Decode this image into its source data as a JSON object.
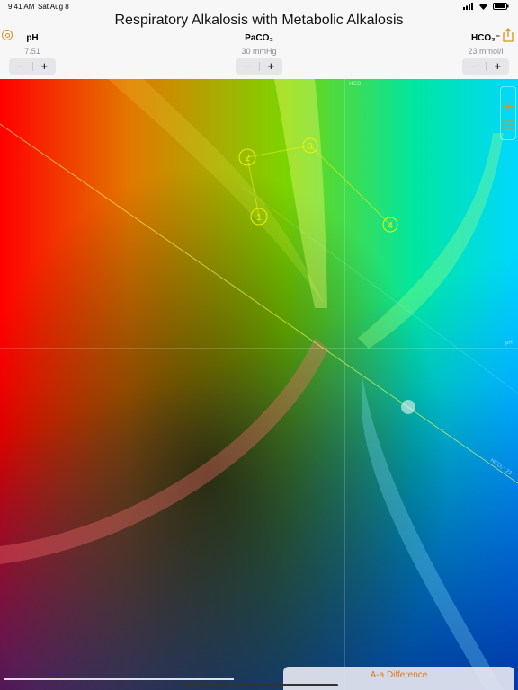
{
  "status": {
    "time": "9:41 AM",
    "date": "Sat Aug 8"
  },
  "title": "Respiratory Alkalosis with Metabolic Alkalosis",
  "params": [
    {
      "label": "pH",
      "value": "7.51"
    },
    {
      "label": "PaCO₂",
      "value": "30 mmHg"
    },
    {
      "label": "HCO₃⁻",
      "value": "23 mmol/l"
    }
  ],
  "stepper": {
    "minus": "−",
    "plus": "+"
  },
  "plot": {
    "axis_labels": {
      "hco2": "HCO₂",
      "ph": "pH",
      "hco3_line": "HCO₃⁻ 23"
    },
    "points": [
      "1",
      "2",
      "3",
      "4"
    ]
  },
  "icons": {
    "settings": "gear-icon",
    "share": "share-icon",
    "add": "plus-icon",
    "list": "list-icon"
  },
  "bottom_tab": {
    "label": "A-a Difference"
  },
  "colors": {
    "accent": "#e07a1e",
    "point": "#f0f000"
  }
}
